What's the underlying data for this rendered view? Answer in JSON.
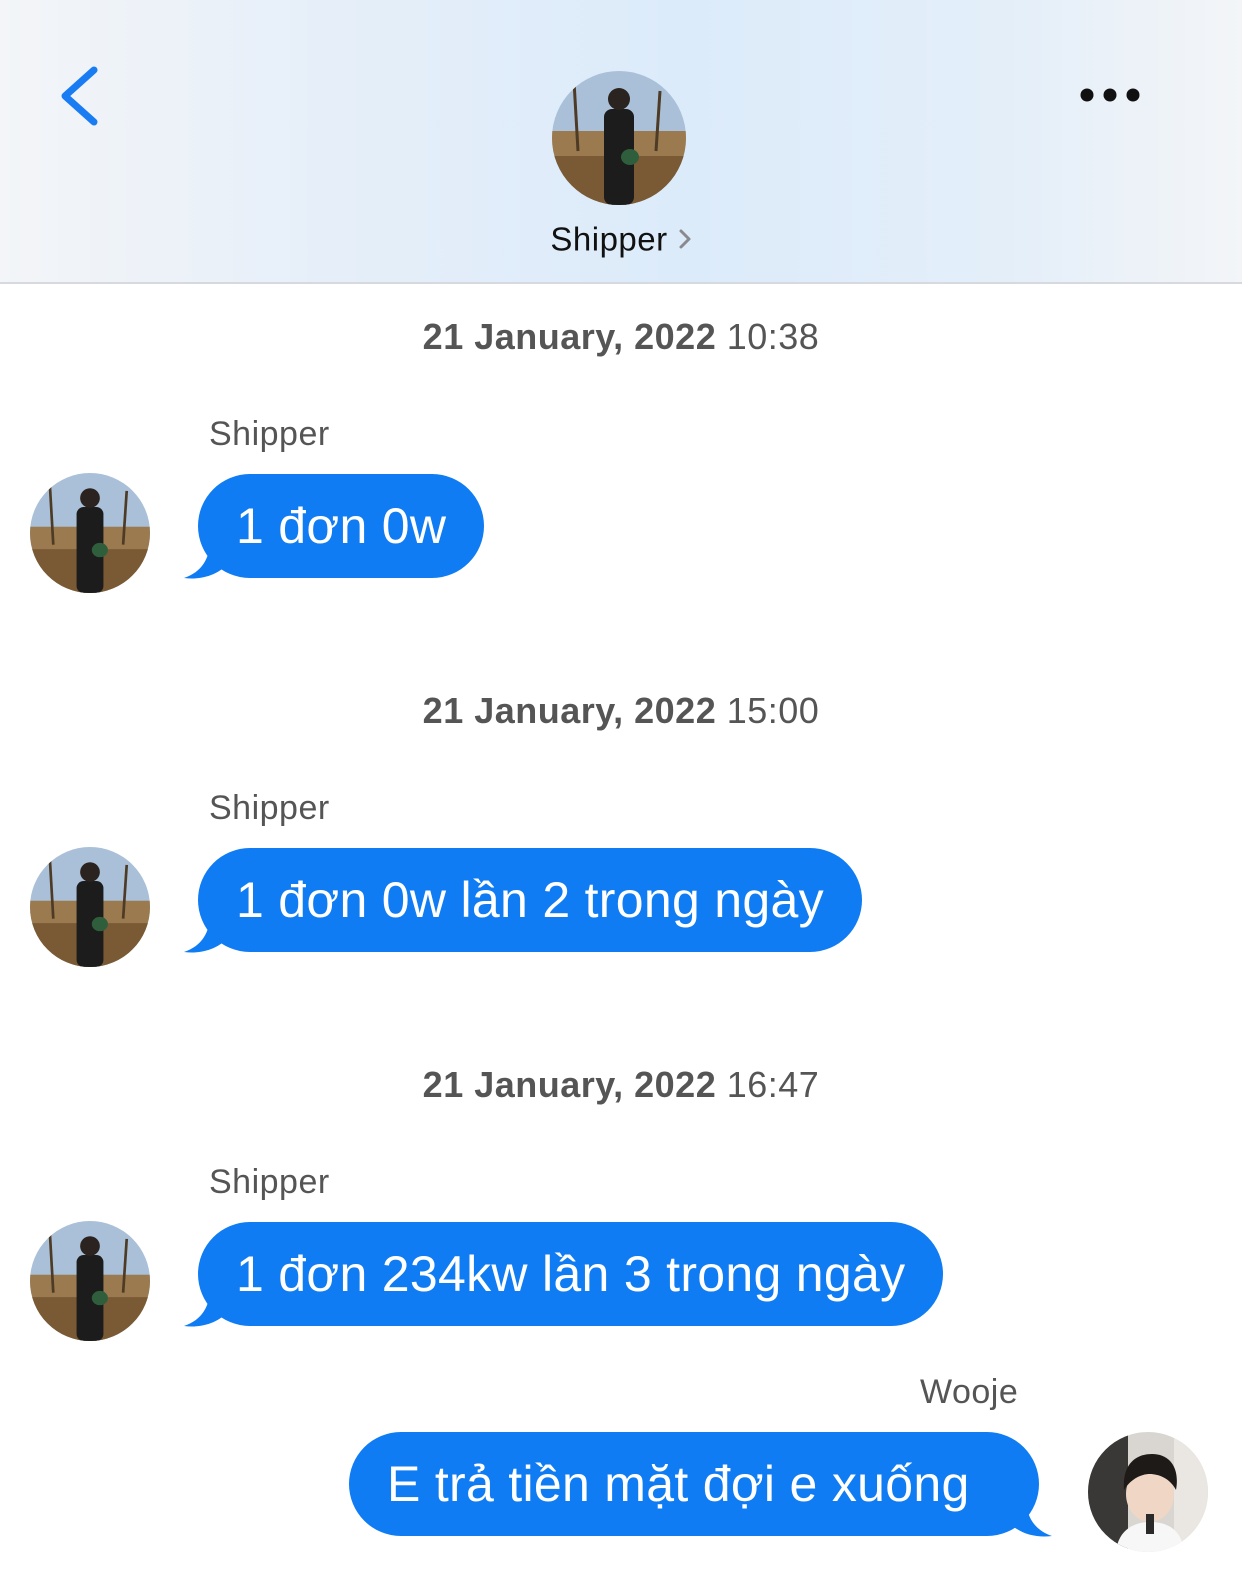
{
  "header": {
    "back_icon": "chevron-left-icon",
    "more_icon": "more-horizontal-icon",
    "contact_name": "Shipper",
    "contact_chevron_icon": "chevron-right-icon",
    "accent_color": "#1a7cf3"
  },
  "messages": [
    {
      "timestamp_date": "21 January, 2022",
      "timestamp_time": "10:38",
      "sender": "Shipper",
      "text": "1 đơn 0w",
      "direction": "incoming"
    },
    {
      "timestamp_date": "21 January, 2022",
      "timestamp_time": "15:00",
      "sender": "Shipper",
      "text": "1 đơn 0w lần 2 trong ngày",
      "direction": "incoming"
    },
    {
      "timestamp_date": "21 January, 2022",
      "timestamp_time": "16:47",
      "sender": "Shipper",
      "text": "1 đơn 234kw lần 3 trong ngày",
      "direction": "incoming"
    },
    {
      "sender": "Wooje",
      "text": "E trả tiền mặt đợi e xuống",
      "direction": "outgoing"
    }
  ],
  "colors": {
    "bubble": "#0f7cf3",
    "bubble_text": "#ffffff",
    "meta_text": "#555555"
  }
}
